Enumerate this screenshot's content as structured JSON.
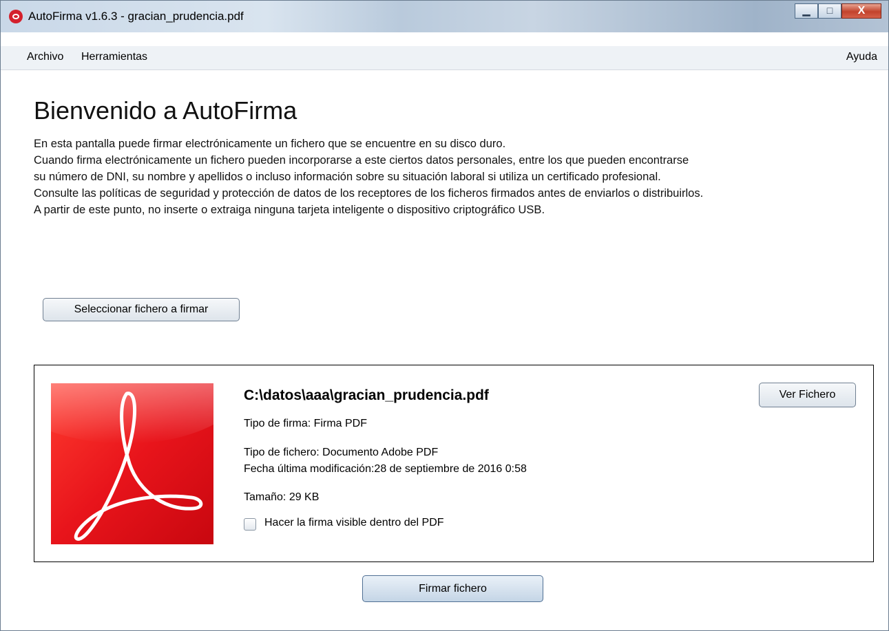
{
  "window": {
    "title": "AutoFirma v1.6.3 - gracian_prudencia.pdf",
    "controls": {
      "minimize": "▁",
      "maximize": "□",
      "close": "X"
    }
  },
  "menu": {
    "archivo": "Archivo",
    "herramientas": "Herramientas",
    "ayuda": "Ayuda"
  },
  "welcome": {
    "title": "Bienvenido a AutoFirma",
    "lines": [
      "En esta pantalla puede firmar electrónicamente un fichero que se encuentre en su disco duro.",
      "Cuando firma electrónicamente un fichero pueden incorporarse a este ciertos datos personales, entre los que pueden encontrarse",
      "su número de DNI, su nombre y apellidos o incluso información sobre su situación laboral si utiliza un certificado profesional.",
      "Consulte las políticas de seguridad y protección de datos de los receptores de los ficheros firmados antes de enviarlos o distribuirlos.",
      "A partir de este punto, no inserte o extraiga ninguna tarjeta inteligente o dispositivo criptográfico USB."
    ]
  },
  "select_button": "Seleccionar fichero a firmar",
  "file": {
    "path": "C:\\datos\\aaa\\gracian_prudencia.pdf",
    "signature_type": "Tipo de firma: Firma PDF",
    "file_type": "Tipo de fichero: Documento Adobe PDF",
    "modified": "Fecha última modificación:28 de septiembre de 2016 0:58",
    "size": "Tamaño: 29 KB",
    "visible_signature_label": "Hacer la firma visible dentro del PDF",
    "visible_signature_checked": false,
    "view_button": "Ver Fichero"
  },
  "sign_button": "Firmar fichero",
  "colors": {
    "pdf_red": "#e8141b",
    "close_button": "#c2432c"
  }
}
